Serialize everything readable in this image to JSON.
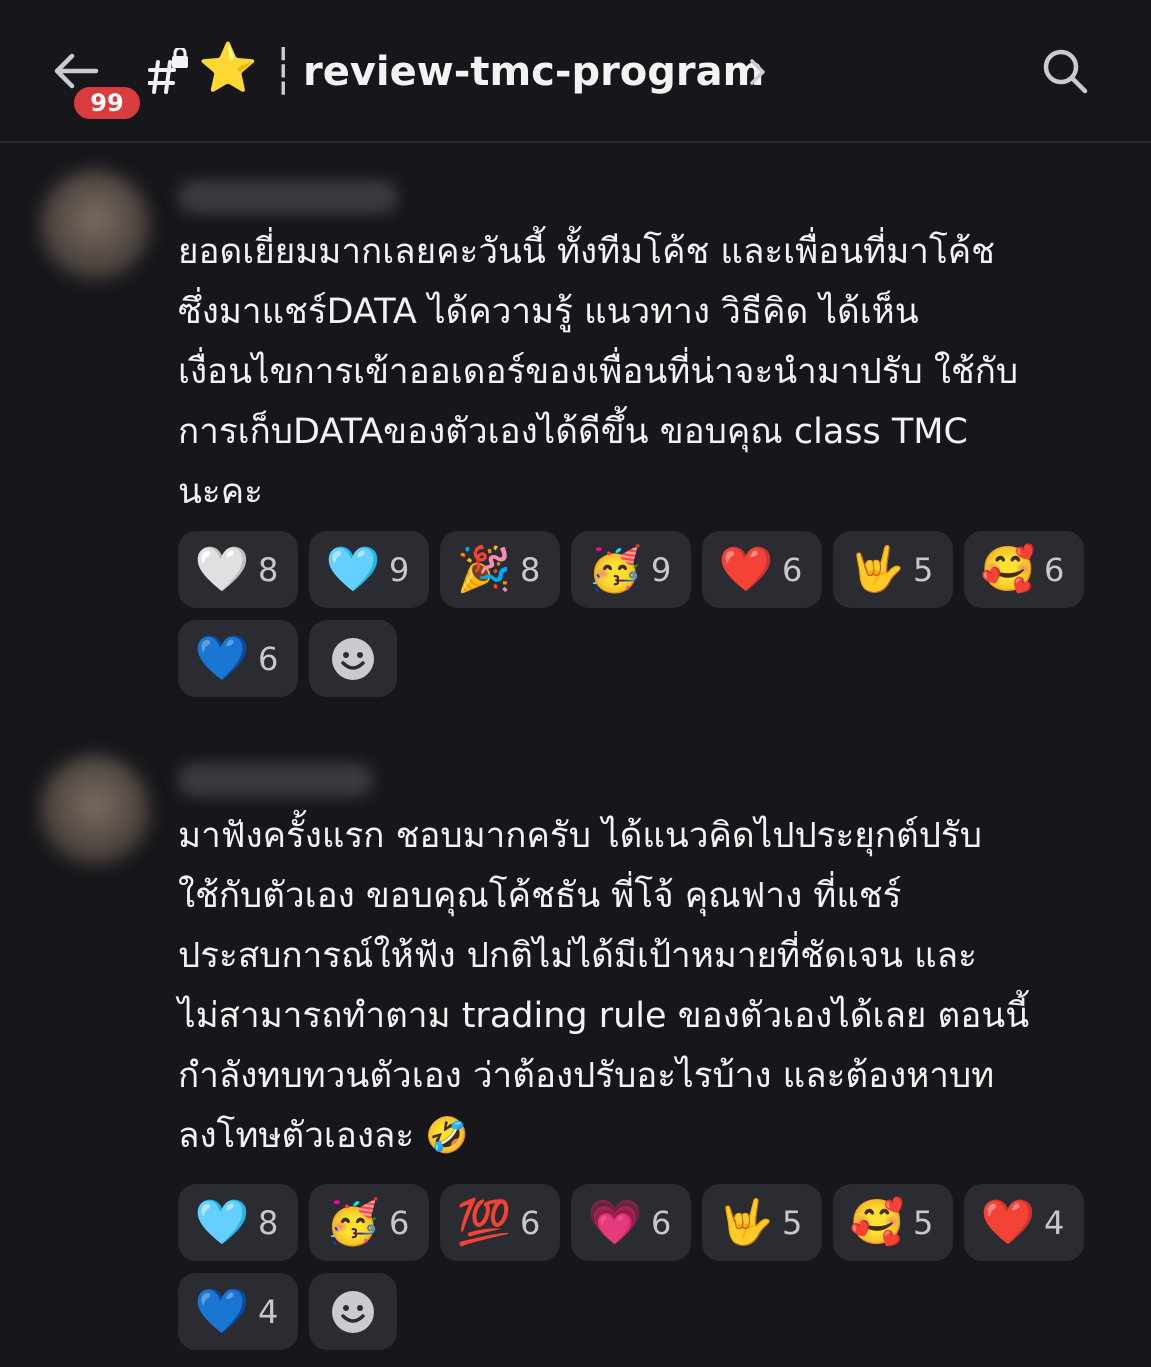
{
  "header": {
    "unread_count": "99",
    "channel_emoji": "⭐",
    "separator": "┆",
    "channel_name": "review-tmc-program"
  },
  "messages": [
    {
      "text": "ยอดเยี่ยมมากเลยคะวันนี้ ทั้งทีมโค้ช และเพื่อนที่มาโค้ช\nซึ่งมาแชร์DATA  ได้ความรู้ แนวทาง วิธีคิด ได้เห็น\nเงื่อนไขการเข้าออเดอร์ของเพื่อนที่น่าจะนำมาปรับ ใช้กับ\nการเก็บDATAของตัวเองได้ดีขึ้น ขอบคุณ class TMC\nนะคะ",
      "reactions": [
        {
          "emoji": "🤍",
          "count": "8"
        },
        {
          "emoji": "🩵",
          "count": "9"
        },
        {
          "emoji": "🎉",
          "count": "8"
        },
        {
          "emoji": "🥳",
          "count": "9"
        },
        {
          "emoji": "❤️",
          "count": "6"
        },
        {
          "emoji": "🤟",
          "count": "5"
        },
        {
          "emoji": "🥰",
          "count": "6"
        },
        {
          "emoji": "💙",
          "count": "6"
        }
      ]
    },
    {
      "text": "มาฟังครั้งแรก ชอบมากครับ ได้แนวคิดไปประยุกต์ปรับ\nใช้กับตัวเอง ขอบคุณโค้ชธัน พี่โจ้ คุณฟาง ที่แชร์\nประสบการณ์ให้ฟัง ปกติไม่ได้มีเป้าหมายที่ชัดเจน และ\nไม่สามารถทำตาม trading rule ของตัวเองได้เลย ตอนนี้\nกำลังทบทวนตัวเอง ว่าต้องปรับอะไรบ้าง และต้องหาบท\nลงโทษตัวเองละ 🤣",
      "reactions": [
        {
          "emoji": "🩵",
          "count": "8"
        },
        {
          "emoji": "🥳",
          "count": "6"
        },
        {
          "emoji": "💯",
          "count": "6"
        },
        {
          "emoji": "💗",
          "count": "6"
        },
        {
          "emoji": "🤟",
          "count": "5"
        },
        {
          "emoji": "🥰",
          "count": "5"
        },
        {
          "emoji": "❤️",
          "count": "4"
        },
        {
          "emoji": "💙",
          "count": "4"
        }
      ]
    }
  ],
  "colors": {
    "background": "#17171b",
    "reaction_bg": "#2b2c31",
    "badge": "#d83c3e",
    "text": "#f2f3f5"
  }
}
